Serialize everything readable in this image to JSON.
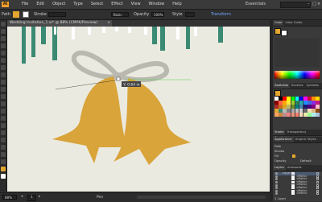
{
  "app": {
    "logo_label": "Ai",
    "menus": [
      "File",
      "Edit",
      "Object",
      "Type",
      "Select",
      "Effect",
      "View",
      "Window",
      "Help"
    ],
    "workspace": "Essentials",
    "window_buttons": [
      "–",
      "□",
      "×"
    ]
  },
  "control_bar": {
    "selection_label": "Path",
    "stroke_label": "Stroke",
    "stroke_weight": "",
    "brush_label": "Basic",
    "opacity_label": "Opacity",
    "opacity_value": "100%",
    "style_label": "Style",
    "transform_label": "Transform",
    "fill_color": "#e3a62f",
    "stroke_color": "#ffffff"
  },
  "document": {
    "tab_title": "Wedding Invitation_1.ai* @ 88% (CMYK/Preview)",
    "close_label": "×"
  },
  "canvas": {
    "smart_guide_label": "Y: 0.64 in",
    "colors": {
      "artboard": "#ebeae1",
      "teal": "#3b8a73",
      "bell": "#d9a43a",
      "ribbon": "#b9b9b0",
      "guide": "#56d34a"
    }
  },
  "status_bar": {
    "zoom": "88%",
    "page": "1",
    "status_text": "Pen",
    "prev_label": "◂",
    "next_label": "▸"
  },
  "panels": {
    "color": {
      "tabs": [
        "Color",
        "Color Guide"
      ],
      "fill_color": "#e3a62f"
    },
    "swatches": {
      "tabs": [
        "Swatches",
        "Brushes",
        "Symbols"
      ],
      "colors": [
        "#ffffff",
        "#000000",
        "#ff0000",
        "#ffff00",
        "#00ff00",
        "#00ffff",
        "#0000ff",
        "#ff00ff",
        "#c8102e",
        "#ff8c00",
        "#ffd700",
        "#8b0000",
        "#ff6347",
        "#ffa500",
        "#ffeb3b",
        "#9acd32",
        "#2e8b57",
        "#20b2aa",
        "#1e90ff",
        "#4169e1",
        "#8a2be2",
        "#c71585",
        "#a52a2a",
        "#d2691e",
        "#daa520",
        "#bdb76b",
        "#6b8e23",
        "#008080",
        "#4682b4",
        "#191970",
        "#4b0082",
        "#800080",
        "#ffc0cb",
        "#e3a62f",
        "#3b8a73",
        "#b9b9b0",
        "#808080",
        "#a9a9a9",
        "#c0c0c0",
        "#d3d3d3",
        "#696969",
        "#f5deb3",
        "#deb887",
        "#8b4513",
        "#f4a460",
        "#cd853f",
        "#bc8f8f",
        "#f08080",
        "#e9967a",
        "#fa8072",
        "#ffdab9",
        "#eee8aa",
        "#98fb98",
        "#afeeee",
        "#b0c4de"
      ]
    },
    "stroke": {
      "tabs": [
        "Stroke",
        "Transparency",
        "Gradient"
      ]
    },
    "appearance": {
      "tabs": [
        "Appearance",
        "Graphic Styles"
      ],
      "path_label": "Path",
      "stroke_label": "Stroke",
      "fill_label": "Fill",
      "opacity_label": "Opacity",
      "opacity_value": "Default"
    },
    "layers": {
      "tabs": [
        "Layers",
        "Artboards"
      ],
      "items": [
        {
          "name": "Layer 1"
        },
        {
          "name": "<Path>"
        },
        {
          "name": "<Path>"
        },
        {
          "name": "<Path>"
        },
        {
          "name": "<Path>"
        },
        {
          "name": "<Path>"
        },
        {
          "name": "<Path>"
        },
        {
          "name": "<Path>"
        }
      ],
      "footer": "1 Layer"
    }
  }
}
